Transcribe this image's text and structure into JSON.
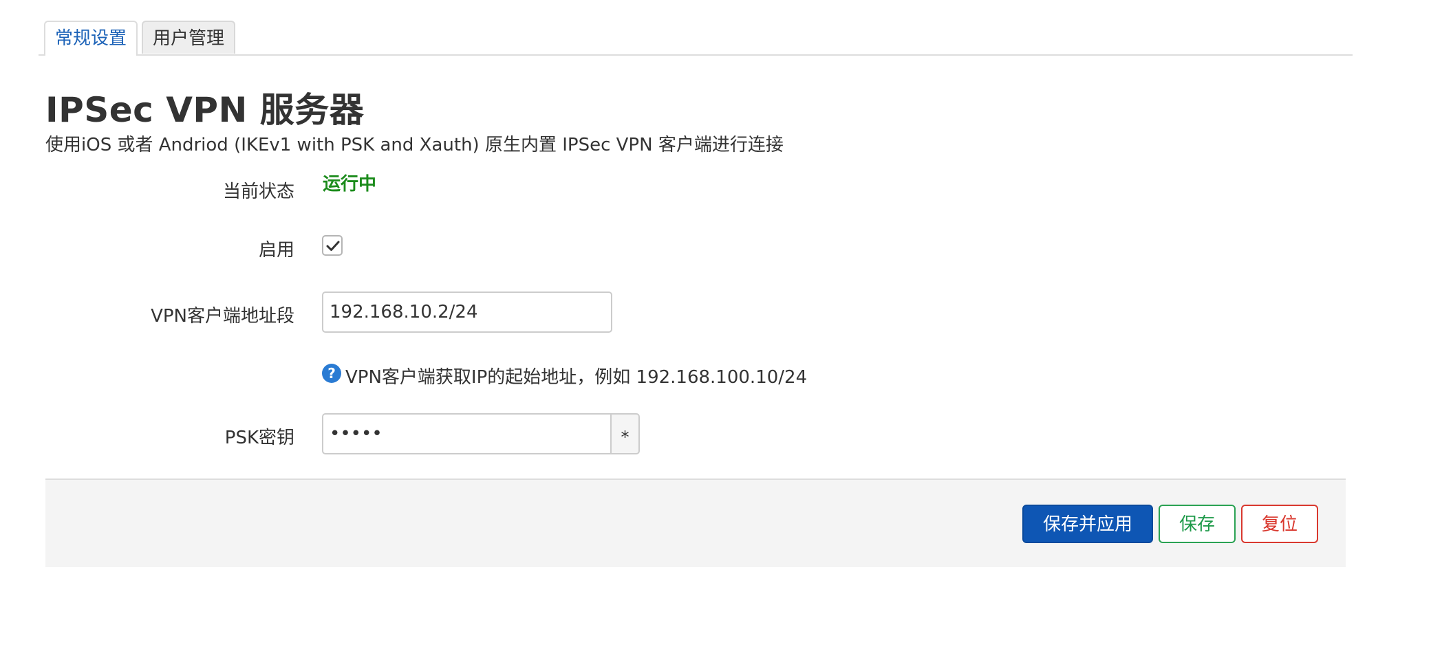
{
  "tabs": [
    {
      "label": "常规设置",
      "active": true
    },
    {
      "label": "用户管理",
      "active": false
    }
  ],
  "header": {
    "title": "IPSec VPN 服务器",
    "description": "使用iOS 或者 Andriod (IKEv1 with PSK and Xauth) 原生内置 IPSec VPN 客户端进行连接"
  },
  "form": {
    "status": {
      "label": "当前状态",
      "value": "运行中"
    },
    "enable": {
      "label": "启用",
      "checked": true
    },
    "client_range": {
      "label": "VPN客户端地址段",
      "value": "192.168.10.2/24",
      "hint": "VPN客户端获取IP的起始地址，例如 192.168.100.10/24"
    },
    "psk": {
      "label": "PSK密钥",
      "value": "•••••",
      "reveal_label": "*"
    }
  },
  "actions": {
    "save_apply": "保存并应用",
    "save": "保存",
    "reset": "复位"
  },
  "colors": {
    "accent": "#0e56b4",
    "status_running": "#1b8b1b",
    "save": "#1f9a4a",
    "reset": "#d9382e",
    "help": "#2a7bd3"
  },
  "icons": {
    "help": "question-icon",
    "checkbox": "checkmark-icon"
  }
}
